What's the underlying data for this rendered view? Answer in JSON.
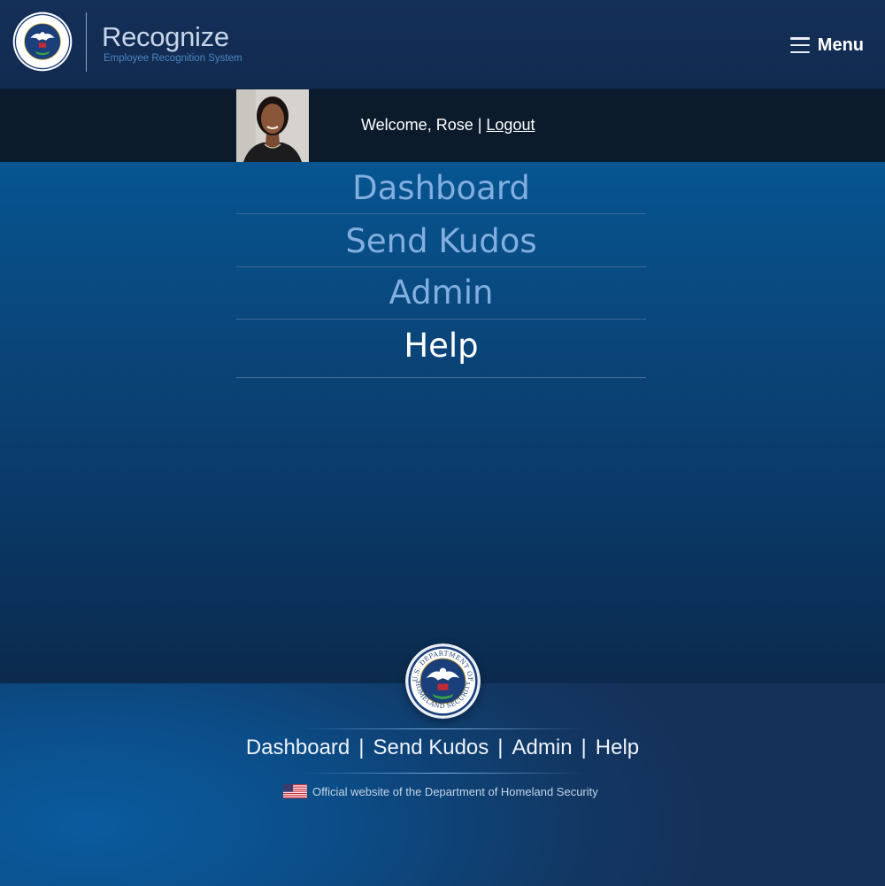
{
  "header": {
    "title": "Recognize",
    "subtitle": "Employee Recognition System",
    "menu_label": "Menu"
  },
  "userbar": {
    "welcome": "Welcome, Rose |",
    "logout": "Logout"
  },
  "nav": {
    "items": [
      {
        "label": "Dashboard",
        "active": false
      },
      {
        "label": "Send Kudos",
        "active": false
      },
      {
        "label": "Admin",
        "active": false
      },
      {
        "label": "Help",
        "active": true
      }
    ]
  },
  "footer": {
    "links": [
      "Dashboard",
      "Send Kudos",
      "Admin",
      "Help"
    ],
    "separator": "|",
    "official": "Official website of the Department of Homeland Security"
  },
  "seal_text": {
    "top": "U.S. DEPARTMENT OF",
    "bottom": "HOMELAND SECURITY"
  },
  "colors": {
    "header_bg": "#142f58",
    "userbar_bg": "#0c1b2c",
    "nav_inactive": "#82aee0",
    "nav_active": "#ffffff",
    "subtitle": "#4d88c3"
  }
}
